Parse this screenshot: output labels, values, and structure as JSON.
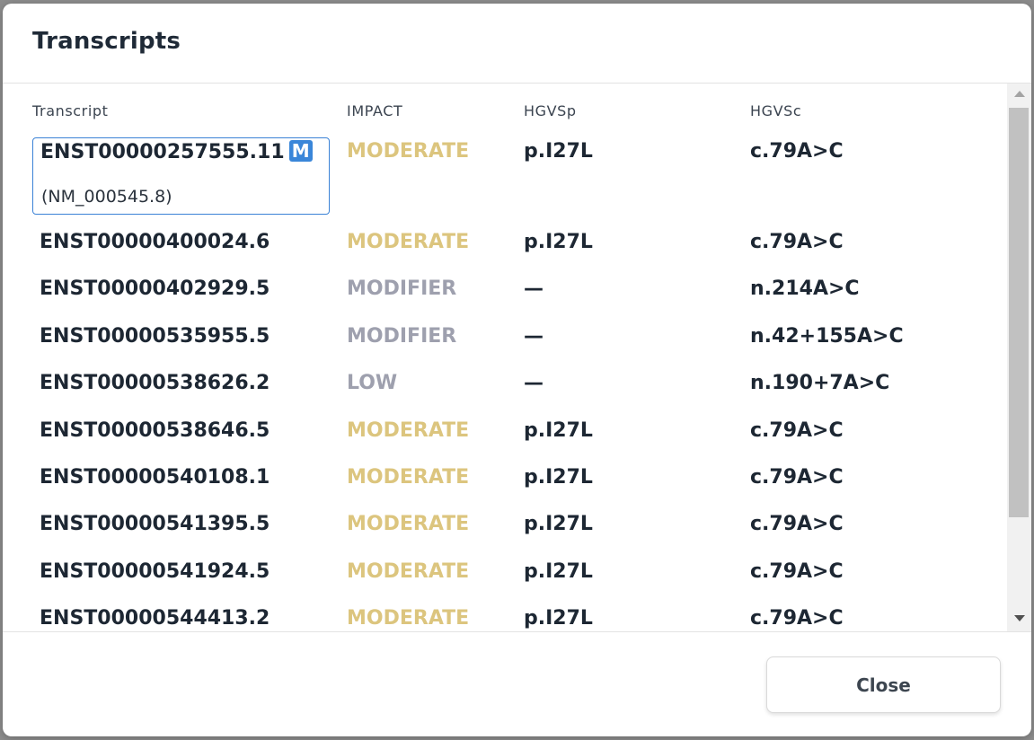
{
  "dialog": {
    "title": "Transcripts",
    "close_label": "Close"
  },
  "table": {
    "columns": [
      "Transcript",
      "IMPACT",
      "HGVSp",
      "HGVSc"
    ],
    "selected": {
      "transcript": "ENST00000257555.11",
      "badge": "M",
      "refseq": "(NM_000545.8)",
      "impact": "MODERATE",
      "hgvsp": "p.I27L",
      "hgvsc": "c.79A>C"
    },
    "rows": [
      {
        "transcript": "ENST00000400024.6",
        "impact": "MODERATE",
        "hgvsp": "p.I27L",
        "hgvsc": "c.79A>C"
      },
      {
        "transcript": "ENST00000402929.5",
        "impact": "MODIFIER",
        "hgvsp": "—",
        "hgvsc": "n.214A>C"
      },
      {
        "transcript": "ENST00000535955.5",
        "impact": "MODIFIER",
        "hgvsp": "—",
        "hgvsc": "n.42+155A>C"
      },
      {
        "transcript": "ENST00000538626.2",
        "impact": "LOW",
        "hgvsp": "—",
        "hgvsc": "n.190+7A>C"
      },
      {
        "transcript": "ENST00000538646.5",
        "impact": "MODERATE",
        "hgvsp": "p.I27L",
        "hgvsc": "c.79A>C"
      },
      {
        "transcript": "ENST00000540108.1",
        "impact": "MODERATE",
        "hgvsp": "p.I27L",
        "hgvsc": "c.79A>C"
      },
      {
        "transcript": "ENST00000541395.5",
        "impact": "MODERATE",
        "hgvsp": "p.I27L",
        "hgvsc": "c.79A>C"
      },
      {
        "transcript": "ENST00000541924.5",
        "impact": "MODERATE",
        "hgvsp": "p.I27L",
        "hgvsc": "c.79A>C"
      },
      {
        "transcript": "ENST00000544413.2",
        "impact": "MODERATE",
        "hgvsp": "p.I27L",
        "hgvsc": "c.79A>C"
      }
    ]
  },
  "colors": {
    "moderate": "#dcc57e",
    "modifier": "#9ea0ae",
    "low": "#9ea0ae",
    "selection_border": "#3b82d6",
    "badge": "#3a86d9"
  },
  "icons": {
    "scroll_up": "triangle-up-icon",
    "scroll_down": "triangle-down-icon"
  }
}
